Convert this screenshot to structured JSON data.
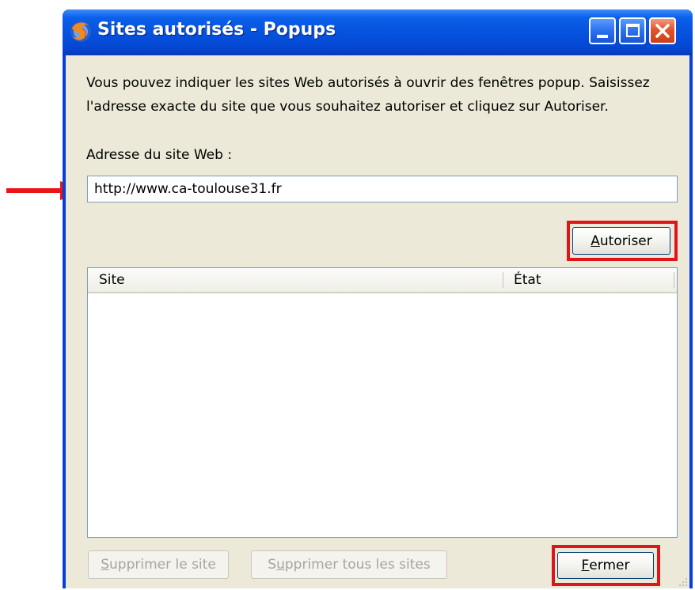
{
  "window": {
    "title": "Sites autorisés - Popups"
  },
  "description": "Vous pouvez indiquer les sites Web autorisés à ouvrir des fenêtres popup. Saisissez l'adresse exacte du site que vous souhaitez autoriser et cliquez sur Autoriser.",
  "address": {
    "label": "Adresse du site Web :",
    "value": "http://www.ca-toulouse31.fr"
  },
  "buttons": {
    "allow_access_key": "A",
    "allow_rest": "utoriser",
    "remove_site_access_key": "S",
    "remove_site_rest": "upprimer le site",
    "remove_all_prefix": "S",
    "remove_all_access_key": "u",
    "remove_all_rest": "pprimer tous les sites",
    "close_access_key": "F",
    "close_rest": "ermer"
  },
  "list": {
    "columns": [
      "Site",
      "État"
    ],
    "rows": []
  },
  "colors": {
    "highlight": "#e0151c",
    "titlebar": "#0553e0",
    "dialog_bg": "#ece9d8"
  }
}
